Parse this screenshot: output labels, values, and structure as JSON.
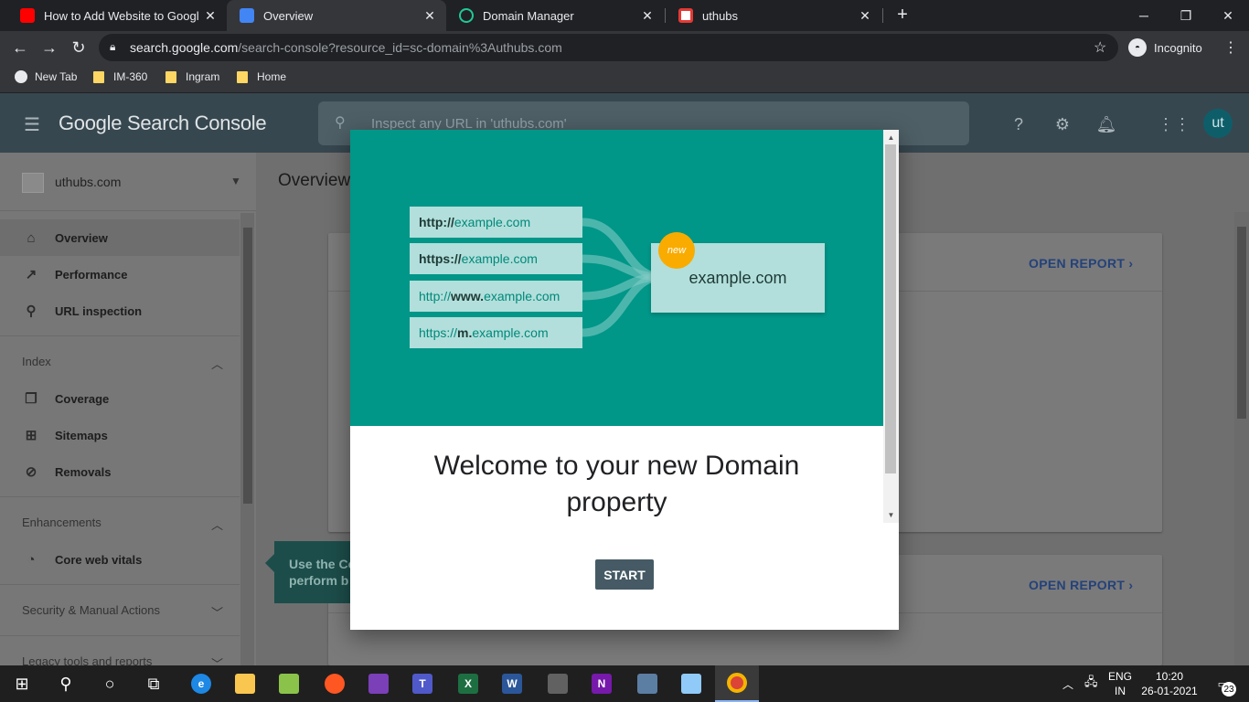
{
  "browser": {
    "tabs": [
      {
        "title": "How to Add Website to Google S",
        "favicon_color": "#ff0000"
      },
      {
        "title": "Overview",
        "favicon_color": "#4285f4"
      },
      {
        "title": "Domain Manager",
        "favicon_color": "#20c997"
      },
      {
        "title": "uthubs",
        "favicon_color": "#e53935"
      }
    ],
    "new_tab": "+",
    "url_host": "search.google.com",
    "url_path": "/search-console?resource_id=sc-domain%3Authubs.com",
    "incognito_label": "Incognito",
    "bookmarks": [
      "New Tab",
      "IM-360",
      "Ingram",
      "Home"
    ]
  },
  "gsc": {
    "logo": "Google Search Console",
    "search_placeholder": "Inspect any URL in 'uthubs.com'",
    "avatar": "ut",
    "property": "uthubs.com",
    "page_title": "Overview",
    "nav": {
      "overview": "Overview",
      "performance": "Performance",
      "url_inspection": "URL inspection",
      "index": "Index",
      "coverage": "Coverage",
      "sitemaps": "Sitemaps",
      "removals": "Removals",
      "enhancements": "Enhancements",
      "core_web_vitals": "Core web vitals",
      "security": "Security & Manual Actions",
      "legacy": "Legacy tools and reports"
    },
    "open_report": "OPEN REPORT",
    "tooltip_line1": "Use the Co",
    "tooltip_line2": "perform b"
  },
  "modal": {
    "urls": [
      {
        "prefix": "http://",
        "rest": "example.com"
      },
      {
        "prefix": "https://",
        "rest": "example.com"
      },
      {
        "pre": "http://",
        "bold": "www.",
        "rest": "example.com"
      },
      {
        "pre": "https://",
        "bold": "m.",
        "rest": "example.com"
      }
    ],
    "badge": "new",
    "target": "example.com",
    "title_line1": "Welcome to your new Domain",
    "title_line2": "property",
    "start": "START",
    "colors": {
      "hero": "#009688",
      "button": "#455a64",
      "badge": "#f9ab00"
    }
  },
  "taskbar": {
    "lang1": "ENG",
    "lang2": "IN",
    "time": "10:20",
    "date": "26-01-2021",
    "notifications": "23"
  }
}
